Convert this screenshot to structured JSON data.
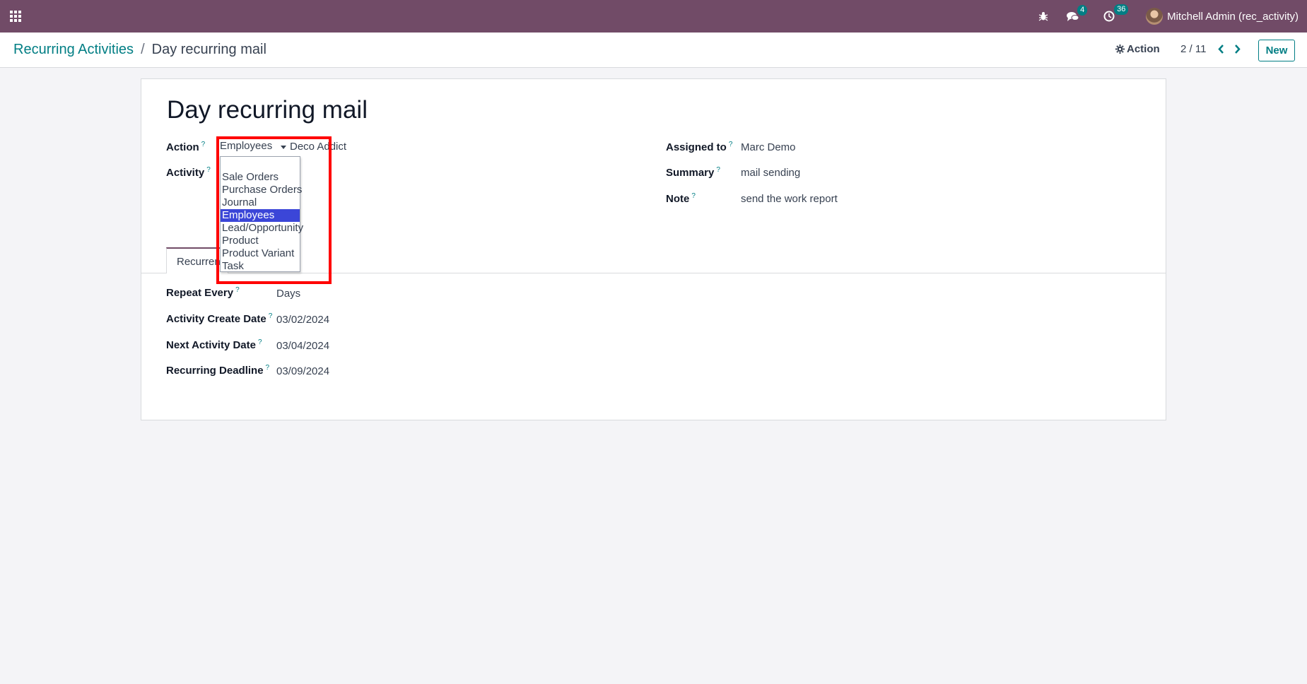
{
  "navbar": {
    "messages_count": "4",
    "activities_count": "36",
    "user_name": "Mitchell Admin (rec_activity)"
  },
  "breadcrumb": {
    "parent": "Recurring Activities",
    "separator": "/",
    "current": "Day recurring mail"
  },
  "control": {
    "action_label": "Action",
    "pager": "2 / 11",
    "new_label": "New"
  },
  "form": {
    "title": "Day recurring mail",
    "action_label": "Action",
    "help_mark": "?",
    "action_model": "Employees",
    "action_reference": "Deco Addict",
    "activity_label": "Activity",
    "assigned_label": "Assigned to",
    "assigned_value": "Marc Demo",
    "summary_label": "Summary",
    "summary_value": "mail sending",
    "note_label": "Note",
    "note_value": "send the work report",
    "tab_label": "Recurrence",
    "repeat_label": "Repeat Every",
    "repeat_value": "Days",
    "create_date_label": "Activity Create Date",
    "create_date_value": "03/02/2024",
    "next_date_label": "Next Activity Date",
    "next_date_value": "03/04/2024",
    "deadline_label": "Recurring Deadline",
    "deadline_value": "03/09/2024"
  },
  "dropdown": {
    "options": [
      "Sale Orders",
      "Purchase Orders",
      "Journal",
      "Employees",
      "Lead/Opportunity",
      "Product",
      "Product Variant",
      "Task"
    ],
    "selected": "Employees"
  },
  "colors": {
    "navbar": "#714b67",
    "accent": "#017e84",
    "selected_option": "#3b46d8",
    "highlight": "#ff0000"
  }
}
